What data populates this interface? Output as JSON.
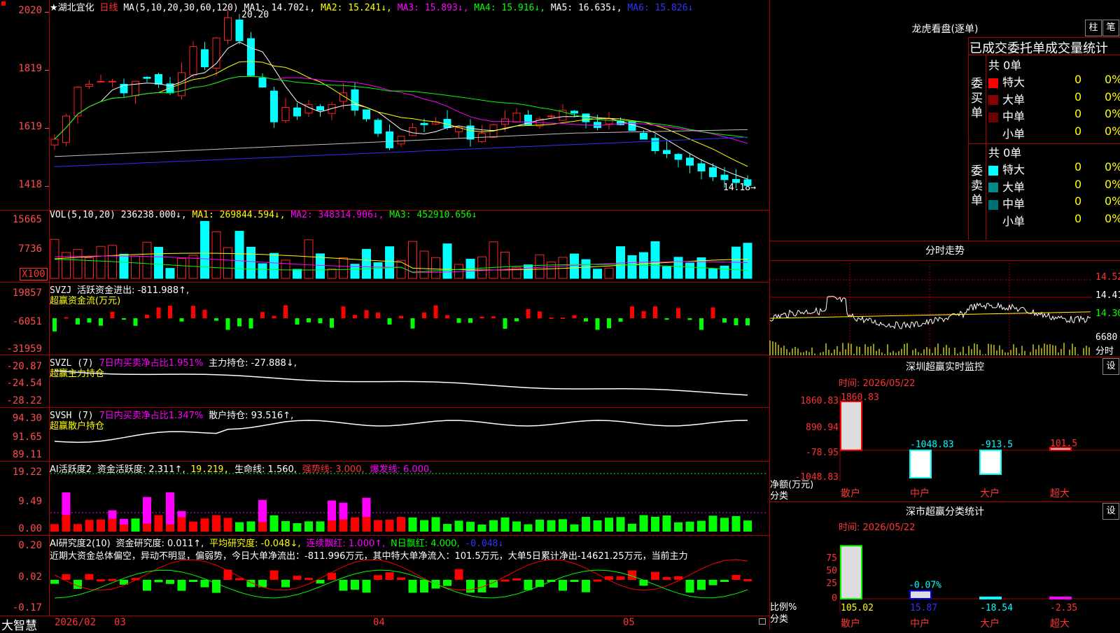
{
  "stock": {
    "name": "★湖北宜化",
    "period": "日线"
  },
  "main": {
    "ma_label": "MA(5,10,20,30,60,120)",
    "ma1": "MA1: 14.702↓,",
    "ma2": "MA2: 15.241↓,",
    "ma3": "MA3: 15.893↓,",
    "ma4": "MA4: 15.916↓,",
    "ma5": "MA5: 16.635↓,",
    "ma6": "MA6: 15.826↓",
    "y_labels": [
      "2020",
      "1819",
      "1619",
      "1418"
    ],
    "high_marker": "20.20",
    "low_marker": "14.18→",
    "colors": {
      "up": "#ff2020",
      "down": "#00ffff",
      "ma1": "#ffffff",
      "ma2": "#ffff00",
      "ma3": "#ff00ff",
      "ma4": "#00ff00",
      "ma5": "#c0c0c0",
      "ma6": "#3030ff"
    }
  },
  "vol": {
    "label": "VOL(5,10,20)",
    "value": "236238.000↓,",
    "ma1": "MA1: 269844.594↓,",
    "ma2": "MA2: 348314.906↓,",
    "ma3": "MA3: 452910.656↓",
    "y_labels": [
      "15665",
      "7736"
    ],
    "unit": "X100"
  },
  "svzj": {
    "label": "SVZJ",
    "text": "活跃资金进出: -811.988↑,",
    "subtitle": "超赢资金流(万元)",
    "y_labels": [
      "19857",
      "-6051",
      "-31959"
    ]
  },
  "svzl": {
    "label": "SVZL (7)",
    "text1": "7日内买卖净占比1.951%",
    "text2": "主力持仓: -27.888↓,",
    "subtitle": "超赢主力持仓",
    "y_labels": [
      "-20.87",
      "-24.54",
      "-28.22"
    ]
  },
  "svsh": {
    "label": "SVSH (7)",
    "text1": "7日内买卖净占比1.347%",
    "text2": "散户持仓: 93.516↑,",
    "subtitle": "超赢散户持仓",
    "y_labels": [
      "94.30",
      "91.65",
      "89.11"
    ]
  },
  "ai1": {
    "label": "AI活跃度2",
    "t1": "资金活跃度: 2.311↑,",
    "t2": "19.219,",
    "t3": "生命线: 1.560,",
    "t4": "强势线: 3.000,",
    "t5": "爆发线: 6.000,",
    "y_labels": [
      "19.22",
      "9.49",
      "0.00"
    ]
  },
  "ai2": {
    "label": "AI研究度2(10)",
    "t1": "资金研究度: 0.011↑,",
    "t2": "平均研究度: -0.048↓,",
    "t3": "连续飘红: 1.000↑,",
    "t4": "N日飘红: 4.000,",
    "t5": "-0.048↓",
    "y_labels": [
      "0.20",
      "0.02",
      "-0.17"
    ],
    "comment": "近期大资金总体偏空，异动不明显，偏弱势，今日大单净流出：-811.996万元，其中特大单净流入：101.5万元，大单5日累计净出-14621.25万元，当前主力"
  },
  "bottom": {
    "brand": "大智慧",
    "dates": [
      "2026/02",
      "03",
      "04",
      "05"
    ]
  },
  "right": {
    "lhb_title": "龙虎看盘(逐单)",
    "btn_zhu": "柱",
    "btn_bi": "笔",
    "stats_title": "已成交委托单成交量统计",
    "buy_label": "委买单",
    "sell_label": "委卖单",
    "buy_total": "共 0单",
    "sell_total": "共 0单",
    "buy_rows": [
      {
        "name": "特大",
        "count": "0",
        "pct": "0%",
        "color": "#ff0000"
      },
      {
        "name": "大单",
        "count": "0",
        "pct": "0%",
        "color": "#8b0000"
      },
      {
        "name": "中单",
        "count": "0",
        "pct": "0%",
        "color": "#6b0000"
      },
      {
        "name": "小单",
        "count": "0",
        "pct": "0%",
        "color": ""
      }
    ],
    "sell_rows": [
      {
        "name": "特大",
        "count": "0",
        "pct": "0%",
        "color": "#00ffff"
      },
      {
        "name": "大单",
        "count": "0",
        "pct": "0%",
        "color": "#008b8b"
      },
      {
        "name": "中单",
        "count": "0",
        "pct": "0%",
        "color": "#007070"
      },
      {
        "name": "小单",
        "count": "0",
        "pct": "0%",
        "color": ""
      }
    ],
    "intraday_title": "分时走势",
    "intraday_y": [
      "14.52",
      "14.41",
      "14.30",
      "6680",
      "分时"
    ],
    "sz_title": "深圳超赢实时监控",
    "sz_btn": "设",
    "sz_time": "时间: 2026/05/22",
    "sz_y": [
      "1860.83",
      "890.94",
      "-78.95",
      "-1048.83"
    ],
    "sz_ylabel": "净额(万元)",
    "sz_xlabel": "分类",
    "sz_bars": [
      {
        "cat": "散户",
        "value": 1860.83,
        "label": "1860.83"
      },
      {
        "cat": "中户",
        "value": -1048.83,
        "label": "-1048.83"
      },
      {
        "cat": "大户",
        "value": -913.5,
        "label": "-913.5"
      },
      {
        "cat": "超大",
        "value": 101.5,
        "label": "101.5"
      }
    ],
    "sm_title": "深市超赢分类统计",
    "sm_btn": "设",
    "sm_time": "时间: 2026/05/22",
    "sm_y": [
      "75",
      "50",
      "25",
      "0"
    ],
    "sm_ylabel": "比例%",
    "sm_xlabel": "分类",
    "sm_bars": [
      {
        "cat": "散户",
        "value": 105.02,
        "label": "105.02"
      },
      {
        "cat": "中户",
        "value": 15.87,
        "label": "15.87",
        "extra": "-0.07%"
      },
      {
        "cat": "大户",
        "value": -18.54,
        "label": "-18.54"
      },
      {
        "cat": "超大",
        "value": -2.35,
        "label": "-2.35"
      }
    ]
  }
}
